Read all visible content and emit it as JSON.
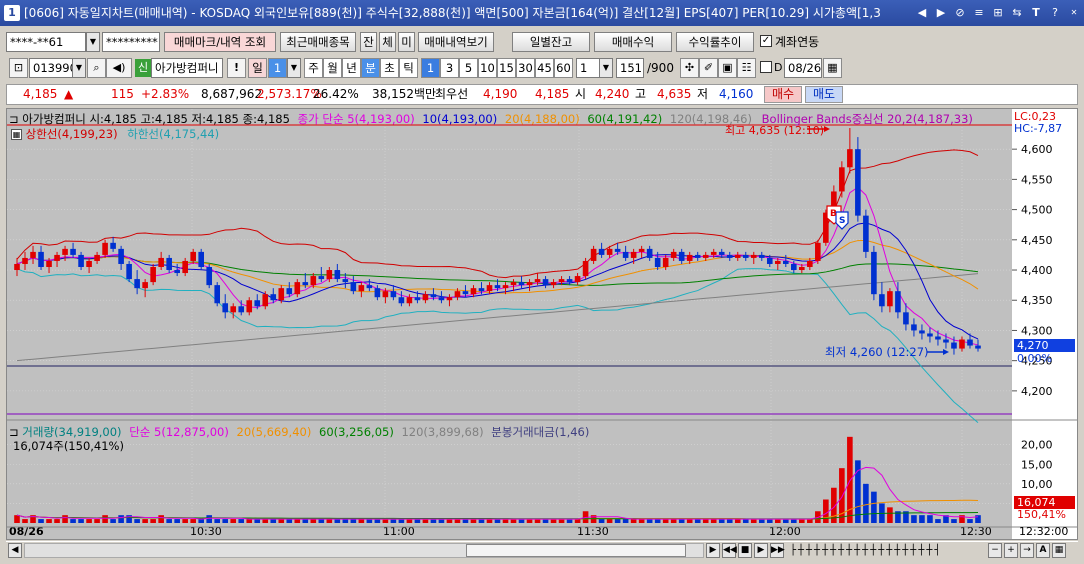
{
  "title": {
    "num": "1",
    "text": "[0606] 자동일지차트(매매내역) - KOSDAQ 외국인보유[889(천)] 주식수[32,888(천)] 액면[500] 자본금[164(억)] 결산[12월] EPS[407] PER[10.29] 시가총액[1,3",
    "icons": [
      "◀",
      "▶",
      "⊘",
      "≡",
      "⊞",
      "⇆",
      "T",
      "?"
    ]
  },
  "toolbar1": {
    "account": "****-**61",
    "password": "*********",
    "trade_mark": "매매마크/내역 조회",
    "recent": "최근매매종목",
    "b_jan": "잔",
    "b_che": "체",
    "b_mi": "미",
    "view": "매매내역보기",
    "daily_balance": "일별잔고",
    "trade_profit": "매매수익",
    "yield_trend": "수익률추이",
    "account_link": "계좌연동",
    "account_link_checked": true
  },
  "toolbar2": {
    "code": "013990",
    "sin": "신",
    "name": "아가방컴퍼니",
    "excl": "!",
    "period_il": "일",
    "period_val": "1",
    "ju": "주",
    "wol": "월",
    "nyeon": "년",
    "bun": "분",
    "cho": "초",
    "tik": "틱",
    "min_opts": [
      "1",
      "3",
      "5",
      "10",
      "15",
      "30",
      "45",
      "60"
    ],
    "min_sel": "1",
    "cnt": "151",
    "cnt_total": "/900",
    "d_label": "D",
    "date": "08/26"
  },
  "quote": {
    "price": "4,185",
    "change_arrow": "▲",
    "change": "115",
    "rate": "+2.83%",
    "volume": "8,687,962",
    "vol_rate": "2,573.17%",
    "turnover": "26.42%",
    "amount": "38,152백만",
    "best_label": "최우선",
    "best_ask": "4,190",
    "best_bid": "4,185",
    "open_label": "시",
    "open": "4,240",
    "high_label": "고",
    "high": "4,635",
    "low_label": "저",
    "low": "4,160",
    "buy": "매수",
    "sell": "매도"
  },
  "legend": {
    "name": "아가방컴퍼니",
    "ohlc": "시:4,185 고:4,185 저:4,185 종:4,185",
    "ma_close": "종가 단순",
    "ma5": "5(4,193,00)",
    "ma10": "10(4,193,00)",
    "ma20": "20(4,188,00)",
    "ma60": "60(4,191,42)",
    "ma120": "120(4,198,46)",
    "bb": "Bollinger Bands중심선 20,2(4,187,33)",
    "upper": "상한선(4,199,23)",
    "lower": "하한선(4,175,44)",
    "lc": "LC:0,23",
    "hc": "HC:-7,87",
    "high_note": "최고 4,635 (12:10)",
    "low_note": "최저 4,260 (12:27)",
    "price_box": "4,270",
    "pct_box": "0.00%"
  },
  "volume_legend": {
    "vol": "거래량(34,919,00)",
    "ma_label": "단순",
    "v5": "5(12,875,00)",
    "v20": "20(5,669,40)",
    "v60": "60(3,256,05)",
    "v120": "120(3,899,68)",
    "amt": "분봉거래대금(1,46)",
    "cur": "16,074주(150,41%)",
    "box1": "16,074",
    "box2": "150,41%"
  },
  "colors": {
    "up": "#e00000",
    "down": "#0030d0",
    "ma5": "#e000e0",
    "ma10": "#0000d0",
    "ma20": "#f09000",
    "ma60": "#008000",
    "ma120": "#808080",
    "bb_upper": "#d00000",
    "bb_lower": "#20b0c0"
  },
  "chart_data": {
    "type": "candlestick",
    "price_axis": {
      "min": 4200,
      "max": 4600,
      "ticks": [
        "4,600",
        "4,550",
        "4,500",
        "4,450",
        "4,400",
        "4,350",
        "4,300",
        "4,250",
        "4,200"
      ]
    },
    "volume_axis": {
      "ticks": [
        "20,00",
        "15,00",
        "10,00",
        "5,00"
      ],
      "unit": "만"
    },
    "time_axis": [
      "08/26",
      "10:30",
      "11:00",
      "11:30",
      "12:00",
      "12:30",
      "12:32:00"
    ],
    "candles": [
      [
        4400,
        4420,
        4390,
        4410
      ],
      [
        4410,
        4430,
        4400,
        4420
      ],
      [
        4420,
        4440,
        4410,
        4430
      ],
      [
        4430,
        4440,
        4400,
        4405
      ],
      [
        4405,
        4420,
        4395,
        4415
      ],
      [
        4415,
        4430,
        4405,
        4425
      ],
      [
        4425,
        4440,
        4415,
        4435
      ],
      [
        4435,
        4445,
        4420,
        4425
      ],
      [
        4425,
        4430,
        4400,
        4405
      ],
      [
        4405,
        4420,
        4395,
        4415
      ],
      [
        4415,
        4430,
        4410,
        4425
      ],
      [
        4425,
        4450,
        4420,
        4445
      ],
      [
        4445,
        4455,
        4430,
        4435
      ],
      [
        4435,
        4440,
        4400,
        4410
      ],
      [
        4410,
        4415,
        4380,
        4385
      ],
      [
        4385,
        4400,
        4360,
        4370
      ],
      [
        4370,
        4385,
        4355,
        4380
      ],
      [
        4380,
        4410,
        4375,
        4405
      ],
      [
        4405,
        4430,
        4400,
        4420
      ],
      [
        4420,
        4425,
        4395,
        4400
      ],
      [
        4400,
        4410,
        4390,
        4395
      ],
      [
        4395,
        4420,
        4390,
        4415
      ],
      [
        4415,
        4435,
        4410,
        4430
      ],
      [
        4430,
        4435,
        4400,
        4405
      ],
      [
        4405,
        4410,
        4370,
        4375
      ],
      [
        4375,
        4380,
        4340,
        4345
      ],
      [
        4345,
        4360,
        4320,
        4330
      ],
      [
        4330,
        4345,
        4320,
        4340
      ],
      [
        4340,
        4350,
        4325,
        4330
      ],
      [
        4330,
        4355,
        4325,
        4350
      ],
      [
        4350,
        4360,
        4335,
        4340
      ],
      [
        4340,
        4365,
        4335,
        4360
      ],
      [
        4360,
        4370,
        4345,
        4350
      ],
      [
        4350,
        4375,
        4345,
        4370
      ],
      [
        4370,
        4380,
        4355,
        4360
      ],
      [
        4360,
        4385,
        4355,
        4380
      ],
      [
        4380,
        4395,
        4370,
        4375
      ],
      [
        4375,
        4395,
        4370,
        4390
      ],
      [
        4390,
        4405,
        4380,
        4385
      ],
      [
        4385,
        4405,
        4380,
        4400
      ],
      [
        4400,
        4410,
        4380,
        4385
      ],
      [
        4385,
        4395,
        4370,
        4380
      ],
      [
        4380,
        4390,
        4360,
        4365
      ],
      [
        4365,
        4380,
        4355,
        4375
      ],
      [
        4375,
        4385,
        4365,
        4370
      ],
      [
        4370,
        4375,
        4350,
        4355
      ],
      [
        4355,
        4370,
        4345,
        4365
      ],
      [
        4365,
        4375,
        4350,
        4355
      ],
      [
        4355,
        4365,
        4340,
        4345
      ],
      [
        4345,
        4360,
        4340,
        4355
      ],
      [
        4355,
        4365,
        4345,
        4350
      ],
      [
        4350,
        4365,
        4345,
        4360
      ],
      [
        4360,
        4370,
        4350,
        4355
      ],
      [
        4355,
        4365,
        4345,
        4350
      ],
      [
        4350,
        4360,
        4340,
        4355
      ],
      [
        4355,
        4370,
        4350,
        4365
      ],
      [
        4365,
        4375,
        4355,
        4360
      ],
      [
        4360,
        4375,
        4355,
        4370
      ],
      [
        4370,
        4380,
        4360,
        4365
      ],
      [
        4365,
        4380,
        4360,
        4375
      ],
      [
        4375,
        4385,
        4365,
        4370
      ],
      [
        4370,
        4380,
        4360,
        4375
      ],
      [
        4375,
        4385,
        4365,
        4380
      ],
      [
        4380,
        4390,
        4370,
        4375
      ],
      [
        4375,
        4385,
        4365,
        4380
      ],
      [
        4380,
        4395,
        4375,
        4385
      ],
      [
        4385,
        4390,
        4370,
        4375
      ],
      [
        4375,
        4385,
        4370,
        4380
      ],
      [
        4380,
        4390,
        4375,
        4385
      ],
      [
        4385,
        4390,
        4375,
        4380
      ],
      [
        4380,
        4395,
        4375,
        4390
      ],
      [
        4390,
        4420,
        4385,
        4415
      ],
      [
        4415,
        4440,
        4410,
        4435
      ],
      [
        4435,
        4445,
        4420,
        4425
      ],
      [
        4425,
        4440,
        4420,
        4435
      ],
      [
        4435,
        4445,
        4425,
        4430
      ],
      [
        4430,
        4440,
        4415,
        4420
      ],
      [
        4420,
        4435,
        4410,
        4430
      ],
      [
        4430,
        4440,
        4420,
        4435
      ],
      [
        4435,
        4440,
        4415,
        4420
      ],
      [
        4420,
        4430,
        4400,
        4405
      ],
      [
        4405,
        4425,
        4400,
        4420
      ],
      [
        4420,
        4435,
        4415,
        4430
      ],
      [
        4430,
        4435,
        4410,
        4415
      ],
      [
        4415,
        4430,
        4410,
        4425
      ],
      [
        4425,
        4430,
        4415,
        4420
      ],
      [
        4420,
        4430,
        4415,
        4425
      ],
      [
        4425,
        4435,
        4420,
        4430
      ],
      [
        4430,
        4435,
        4420,
        4425
      ],
      [
        4425,
        4430,
        4415,
        4420
      ],
      [
        4420,
        4430,
        4415,
        4425
      ],
      [
        4425,
        4430,
        4415,
        4420
      ],
      [
        4420,
        4430,
        4410,
        4425
      ],
      [
        4425,
        4430,
        4415,
        4420
      ],
      [
        4420,
        4425,
        4405,
        4410
      ],
      [
        4410,
        4420,
        4400,
        4415
      ],
      [
        4415,
        4425,
        4405,
        4410
      ],
      [
        4410,
        4415,
        4395,
        4400
      ],
      [
        4400,
        4410,
        4395,
        4405
      ],
      [
        4405,
        4420,
        4400,
        4415
      ],
      [
        4415,
        4450,
        4410,
        4445
      ],
      [
        4445,
        4500,
        4440,
        4495
      ],
      [
        4495,
        4540,
        4480,
        4530
      ],
      [
        4530,
        4580,
        4520,
        4570
      ],
      [
        4570,
        4635,
        4560,
        4600
      ],
      [
        4600,
        4620,
        4480,
        4490
      ],
      [
        4490,
        4500,
        4420,
        4430
      ],
      [
        4430,
        4440,
        4350,
        4360
      ],
      [
        4360,
        4380,
        4330,
        4340
      ],
      [
        4340,
        4370,
        4330,
        4365
      ],
      [
        4365,
        4380,
        4320,
        4330
      ],
      [
        4330,
        4345,
        4300,
        4310
      ],
      [
        4310,
        4320,
        4290,
        4300
      ],
      [
        4300,
        4310,
        4285,
        4295
      ],
      [
        4295,
        4305,
        4280,
        4290
      ],
      [
        4290,
        4300,
        4275,
        4285
      ],
      [
        4285,
        4295,
        4270,
        4280
      ],
      [
        4280,
        4290,
        4260,
        4270
      ],
      [
        4270,
        4290,
        4265,
        4285
      ],
      [
        4285,
        4295,
        4270,
        4275
      ],
      [
        4275,
        4285,
        4265,
        4270
      ]
    ],
    "volumes": [
      2,
      1,
      2,
      1,
      1,
      1,
      2,
      1,
      1,
      1,
      1,
      2,
      1,
      2,
      2,
      1,
      1,
      1,
      2,
      1,
      1,
      1,
      1,
      1,
      2,
      1,
      1,
      1,
      1,
      1,
      1,
      1,
      1,
      1,
      1,
      1,
      1,
      1,
      1,
      1,
      1,
      1,
      1,
      1,
      1,
      1,
      1,
      1,
      1,
      1,
      1,
      1,
      1,
      1,
      1,
      1,
      1,
      1,
      1,
      1,
      1,
      1,
      1,
      1,
      1,
      1,
      1,
      1,
      1,
      1,
      1,
      3,
      2,
      1,
      1,
      1,
      1,
      1,
      1,
      1,
      1,
      1,
      1,
      1,
      1,
      1,
      1,
      1,
      1,
      1,
      1,
      1,
      1,
      1,
      1,
      1,
      1,
      1,
      1,
      1,
      3,
      6,
      9,
      14,
      22,
      16,
      10,
      8,
      5,
      4,
      3,
      3,
      2,
      2,
      2,
      1,
      2,
      1,
      2,
      1,
      2
    ]
  }
}
